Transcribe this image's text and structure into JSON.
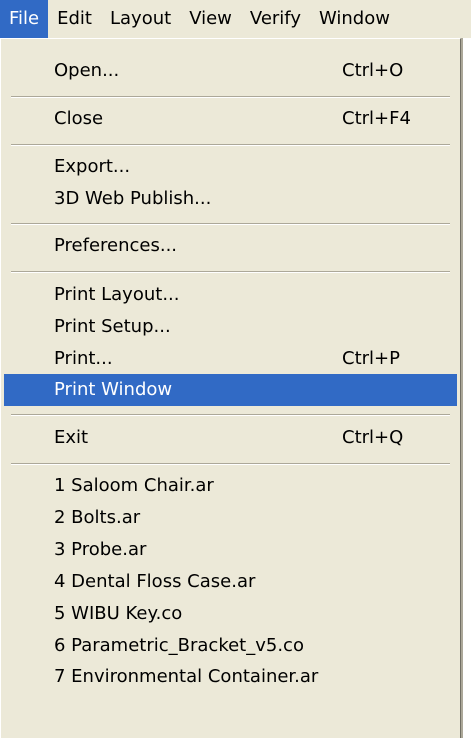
{
  "menubar": {
    "items": [
      {
        "label": "File",
        "active": true
      },
      {
        "label": "Edit"
      },
      {
        "label": "Layout"
      },
      {
        "label": "View"
      },
      {
        "label": "Verify"
      },
      {
        "label": "Window"
      }
    ]
  },
  "menu": {
    "open": {
      "label": "Open...",
      "shortcut": "Ctrl+O"
    },
    "close": {
      "label": "Close",
      "shortcut": "Ctrl+F4"
    },
    "export": {
      "label": "Export..."
    },
    "web_publish": {
      "label": "3D Web Publish..."
    },
    "preferences": {
      "label": "Preferences..."
    },
    "print_layout": {
      "label": "Print Layout..."
    },
    "print_setup": {
      "label": "Print Setup..."
    },
    "print": {
      "label": "Print...",
      "shortcut": "Ctrl+P"
    },
    "print_window": {
      "label": "Print Window",
      "highlighted": true
    },
    "exit": {
      "label": "Exit",
      "shortcut": "Ctrl+Q"
    },
    "recent_files": [
      "1 Saloom Chair.ar",
      "2 Bolts.ar",
      "3 Probe.ar",
      "4 Dental Floss Case.ar",
      "5 WIBU Key.co",
      "6 Parametric_Bracket_v5.co",
      "7 Environmental Container.ar"
    ]
  },
  "colors": {
    "menu_background": "#ece9d8",
    "highlight": "#316ac5",
    "highlight_text": "#ffffff",
    "separator_dark": "#aca899"
  }
}
